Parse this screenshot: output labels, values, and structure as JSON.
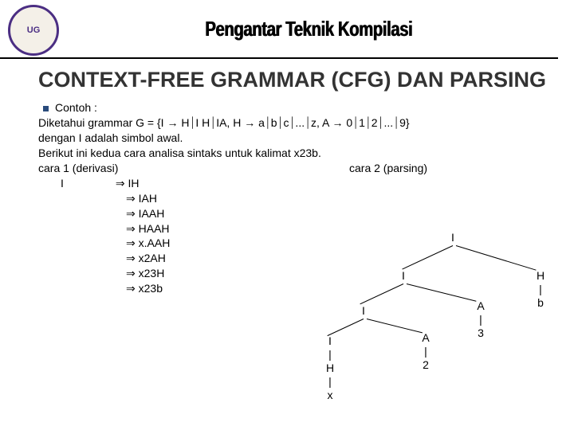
{
  "header": {
    "logo_text": "UG",
    "course_title": "Pengantar Teknik Kompilasi"
  },
  "title": "CONTEXT-FREE GRAMMAR (CFG) DAN PARSING",
  "body": {
    "contoh_label": "Contoh :",
    "grammar_line": "Diketahui grammar G = {I → H⏐I H⏐IA,  H → a⏐b⏐c⏐...⏐z,  A → 0⏐1⏐2⏐...⏐9}",
    "start_symbol": "dengan I adalah simbol awal.",
    "intro_sentence": "Berikut ini kedua cara analisa sintaks untuk kalimat x23b.",
    "cara1": "cara 1 (derivasi)",
    "cara2": "cara 2 (parsing)"
  },
  "derivation": {
    "start": "I",
    "steps": [
      "IH",
      "IAH",
      "IAAH",
      "HAAH",
      "x.AAH",
      "x2AH",
      "x23H",
      "x23b"
    ]
  },
  "tree": {
    "labels": {
      "root": "I",
      "l1_left": "I",
      "l1_right": "H",
      "l2_left": "I",
      "l2_right": "A",
      "l3_left": "I",
      "l3_right": "A",
      "leaf_H_right": "b",
      "leaf_A_right": "3",
      "leaf_A_left": "2",
      "leaf_I_H": "H",
      "leaf_I_x": "x",
      "bar": "|"
    }
  }
}
